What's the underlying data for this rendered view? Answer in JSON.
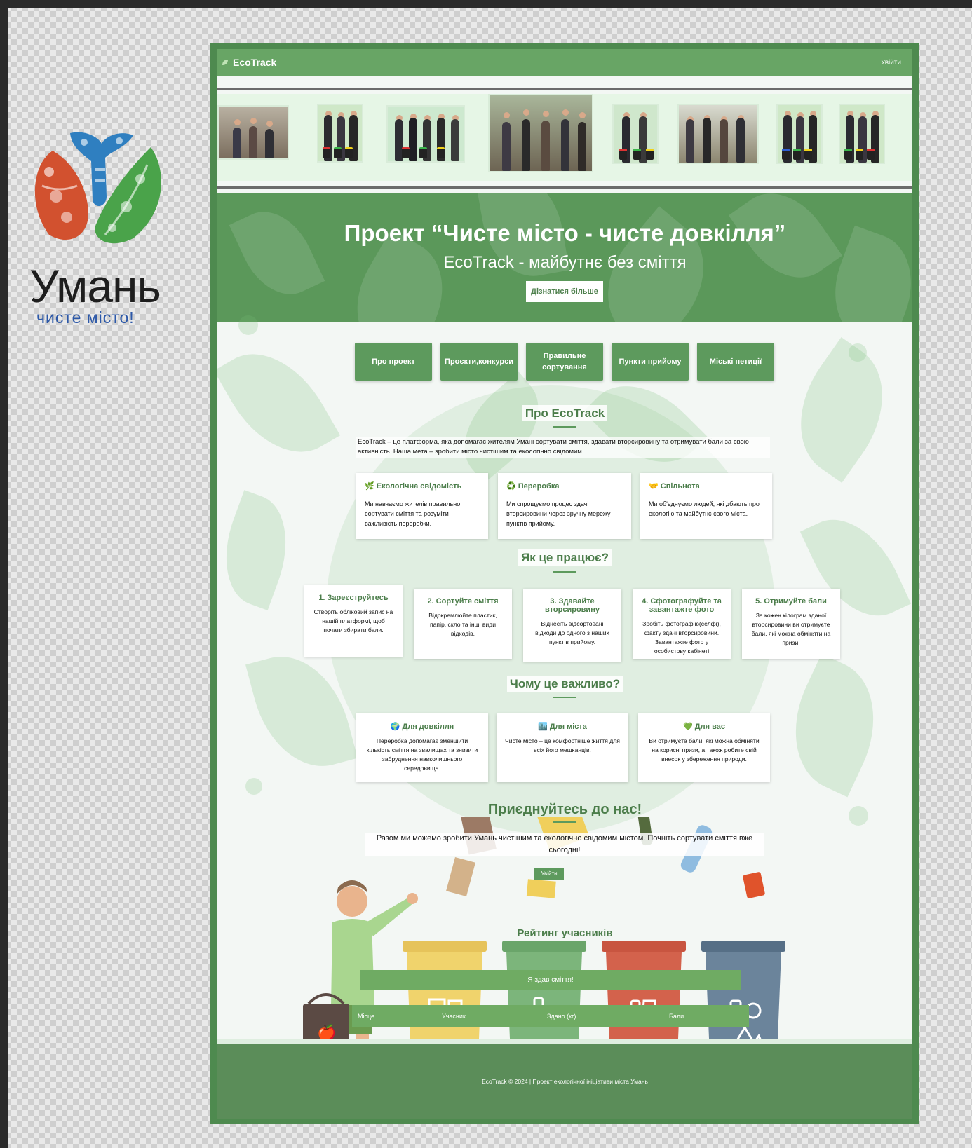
{
  "logo": {
    "title": "Умань",
    "subtitle": "чисте місто!"
  },
  "site": {
    "brand": "EcoTrack",
    "nav_login": "Увійти",
    "hero": {
      "title": "Проект “Чисте місто - чисте довкілля”",
      "subtitle": "EcoTrack -  майбутнє без сміття",
      "button": "Дізнатися більше"
    },
    "menu": [
      "Про проект",
      "Проєкти,конкурси",
      "Правильне сортування",
      "Пункти прийому",
      "Міські петиції"
    ],
    "about": {
      "title": "Про EcoTrack",
      "text": "EcoTrack – це платформа, яка допомагає жителям Умані сортувати сміття, здавати вторсировину та отримувати бали за свою активність. Наша мета – зробити місто чистішим та екологічно свідомим.",
      "cards": [
        {
          "title": "🌿 Екологічна свідомість",
          "text": "Ми навчаємо жителів правильно сортувати сміття та розуміти важливість переробки."
        },
        {
          "title": "♻️ Переробка",
          "text": "Ми спрощуємо процес здачі вторсировини через зручну мережу пунктів прийому."
        },
        {
          "title": "🤝 Спільнота",
          "text": "Ми об'єднуємо людей, які дбають про екологію та майбутнє свого міста."
        }
      ]
    },
    "how": {
      "title": "Як це працює?",
      "steps": [
        {
          "title": "1. Зареєструйтесь",
          "text": "Створіть обліковий запис на нашій платформі, щоб почати збирати бали."
        },
        {
          "title": "2. Сортуйте сміття",
          "text": "Відокремлюйте пластик, папір, скло та інші види відходів."
        },
        {
          "title": "3. Здавайте вторсировину",
          "text": "Віднесіть відсортовані відходи до одного з наших пунктів прийому."
        },
        {
          "title": "4. Сфотографуйте та завантажте фото",
          "text": "Зробіть фотографію(селфі), факту здачі вторсировини. Завантажте фото у особистову кабінеті"
        },
        {
          "title": "5. Отримуйте бали",
          "text": "За кожен кілограм зданої вторсировини ви отримуєте бали, які можна обміняти на призи."
        }
      ]
    },
    "why": {
      "title": "Чому це важливо?",
      "cards": [
        {
          "title": "🌍 Для довкілля",
          "text": "Переробка допомагає зменшити кількість сміття на звалищах та знизити забруднення навколишнього середовища."
        },
        {
          "title": "🏙️ Для міста",
          "text": "Чисте місто – це комфортніше життя для всіх його мешканців."
        },
        {
          "title": "💚 Для вас",
          "text": "Ви отримуєте бали, які можна обміняти на корисні призи, а також робите свій внесок у збереження природи."
        }
      ]
    },
    "join": {
      "title": "Приєднуйтесь до нас!",
      "text": "Разом ми можемо зробити Умань чистішим та екологічно свідомим містом. Почніть сортувати сміття вже сьогодні!",
      "button": "Увійти"
    },
    "rating": {
      "title": "Рейтинг учасників",
      "handed_button": "Я здав сміття!",
      "columns": [
        "Місце",
        "Учасник",
        "Здано (кг)",
        "Бали"
      ]
    },
    "footer": "EcoTrack © 2024 | Проект екологічної ініціативи міста Умань"
  },
  "colors": {
    "frame": "#4e8a4f",
    "nav": "#68a565",
    "accent": "#5d9a5d",
    "heading": "#4b7d4a",
    "logo_red": "#d2512f",
    "logo_blue": "#2f7fc0",
    "logo_green": "#4aa34a",
    "logo_subtitle": "#2c58a8"
  }
}
